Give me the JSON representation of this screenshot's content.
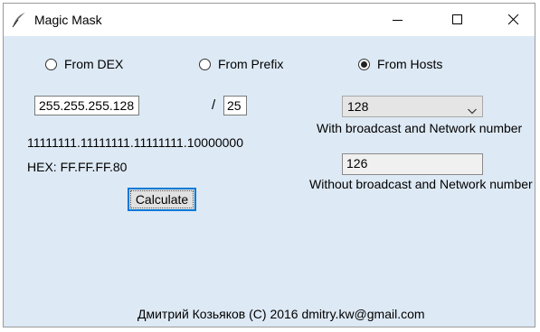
{
  "window": {
    "title": "Magic Mask",
    "icon": "quill-pen-icon"
  },
  "title_buttons": {
    "minimize": "minimize-icon",
    "maximize": "maximize-icon",
    "close": "close-icon"
  },
  "mode": {
    "options": [
      {
        "label": "From DEX",
        "checked": false
      },
      {
        "label": "From Prefix",
        "checked": false
      },
      {
        "label": "From Hosts",
        "checked": true
      }
    ]
  },
  "inputs": {
    "ip_value": "255.255.255.128",
    "slash": "/",
    "prefix_value": "25",
    "hosts_select_value": "128",
    "hosts_without_value": "126"
  },
  "labels": {
    "with_broadcast": "With broadcast and Network number",
    "without_broadcast": "Without broadcast and Network number",
    "binary": "11111111.11111111.11111111.10000000",
    "hex": "HEX: FF.FF.FF.80"
  },
  "buttons": {
    "calculate": "Calculate"
  },
  "footer": {
    "text": "Дмитрий Козьяков (C) 2016 dmitry.kw@gmail.com"
  },
  "colors": {
    "window_bg": "#dde9f4",
    "accent": "#0078d7"
  }
}
